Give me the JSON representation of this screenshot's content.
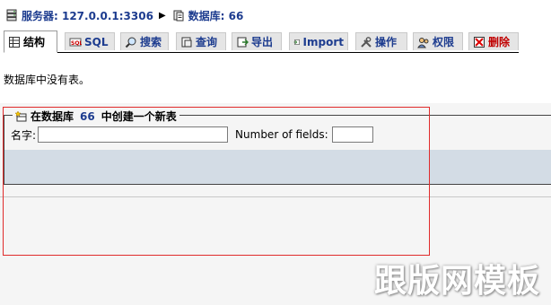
{
  "breadcrumb": {
    "server_label": "服务器: 127.0.0.1:3306",
    "separator": "▶",
    "database_label": "数据库: 66"
  },
  "tabs": [
    {
      "label": "结构",
      "icon": "structure-icon",
      "active": true
    },
    {
      "label": "SQL",
      "icon": "sql-icon"
    },
    {
      "label": "搜索",
      "icon": "search-icon"
    },
    {
      "label": "查询",
      "icon": "query-icon"
    },
    {
      "label": "导出",
      "icon": "export-icon"
    },
    {
      "label": "Import",
      "icon": "import-icon"
    },
    {
      "label": "操作",
      "icon": "operations-icon"
    },
    {
      "label": "权限",
      "icon": "privileges-icon"
    },
    {
      "label": "删除",
      "icon": "drop-icon",
      "danger": true
    }
  ],
  "message": "数据库中没有表。",
  "create_table": {
    "legend_prefix": "在数据库",
    "db_name": "66",
    "legend_suffix": "中创建一个新表",
    "name_label": "名字:",
    "name_value": "",
    "fields_label": "Number of fields:",
    "fields_value": ""
  },
  "watermark": "跟版网模板",
  "colors": {
    "link": "#1d3c8f",
    "danger": "#c00000",
    "band": "#d3dce5",
    "selection": "#e02b2b"
  }
}
